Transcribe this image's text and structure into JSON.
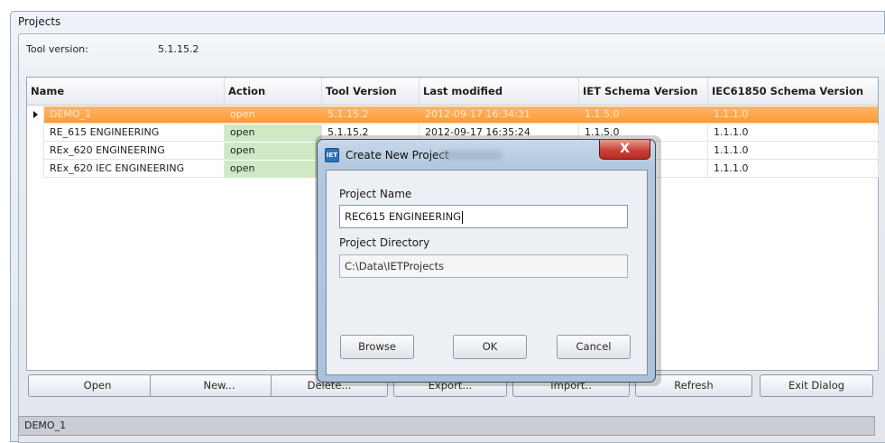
{
  "window": {
    "title": "Projects"
  },
  "tool_version": {
    "label": "Tool version:",
    "value": "5.1.15.2"
  },
  "table": {
    "columns": [
      "Name",
      "Action",
      "Tool Version",
      "Last modified",
      "IET Schema Version",
      "IEC61850 Schema Version"
    ],
    "rows": [
      {
        "name": "DEMO_1",
        "action": "open",
        "tool_version": "5.1.15.2",
        "last_modified": "2012-09-17 16:34:31",
        "iet_schema": "1.1.5.0",
        "iec_schema": "1.1.1.0",
        "selected": true
      },
      {
        "name": "RE_615 ENGINEERING",
        "action": "open",
        "tool_version": "5.1.15.2",
        "last_modified": "2012-09-17 16:35:24",
        "iet_schema": "1.1.5.0",
        "iec_schema": "1.1.1.0",
        "selected": false
      },
      {
        "name": "REx_620 ENGINEERING",
        "action": "open",
        "tool_version": "",
        "last_modified": "",
        "iet_schema": "",
        "iec_schema": "1.1.1.0",
        "selected": false
      },
      {
        "name": "REx_620 IEC ENGINEERING",
        "action": "open",
        "tool_version": "",
        "last_modified": "",
        "iet_schema": "",
        "iec_schema": "1.1.1.0",
        "selected": false
      }
    ]
  },
  "buttons": {
    "open": "Open",
    "new": "New...",
    "delete": "Delete...",
    "export": "Export...",
    "import": "Import..",
    "refresh": "Refresh",
    "exit": "Exit Dialog"
  },
  "status_bar": {
    "text": "DEMO_1"
  },
  "dialog": {
    "icon_text": "IET",
    "title": "Create New Project",
    "close_symbol": "X",
    "project_name_label": "Project Name",
    "project_name_value": "REC615 ENGINEERING",
    "project_dir_label": "Project Directory",
    "project_dir_value": "C:\\Data\\IETProjects",
    "browse": "Browse",
    "ok": "OK",
    "cancel": "Cancel"
  },
  "colors": {
    "selected_row": "#ff9a34",
    "action_open_bg": "#cfe9c5",
    "close_button": "#c7433a"
  }
}
